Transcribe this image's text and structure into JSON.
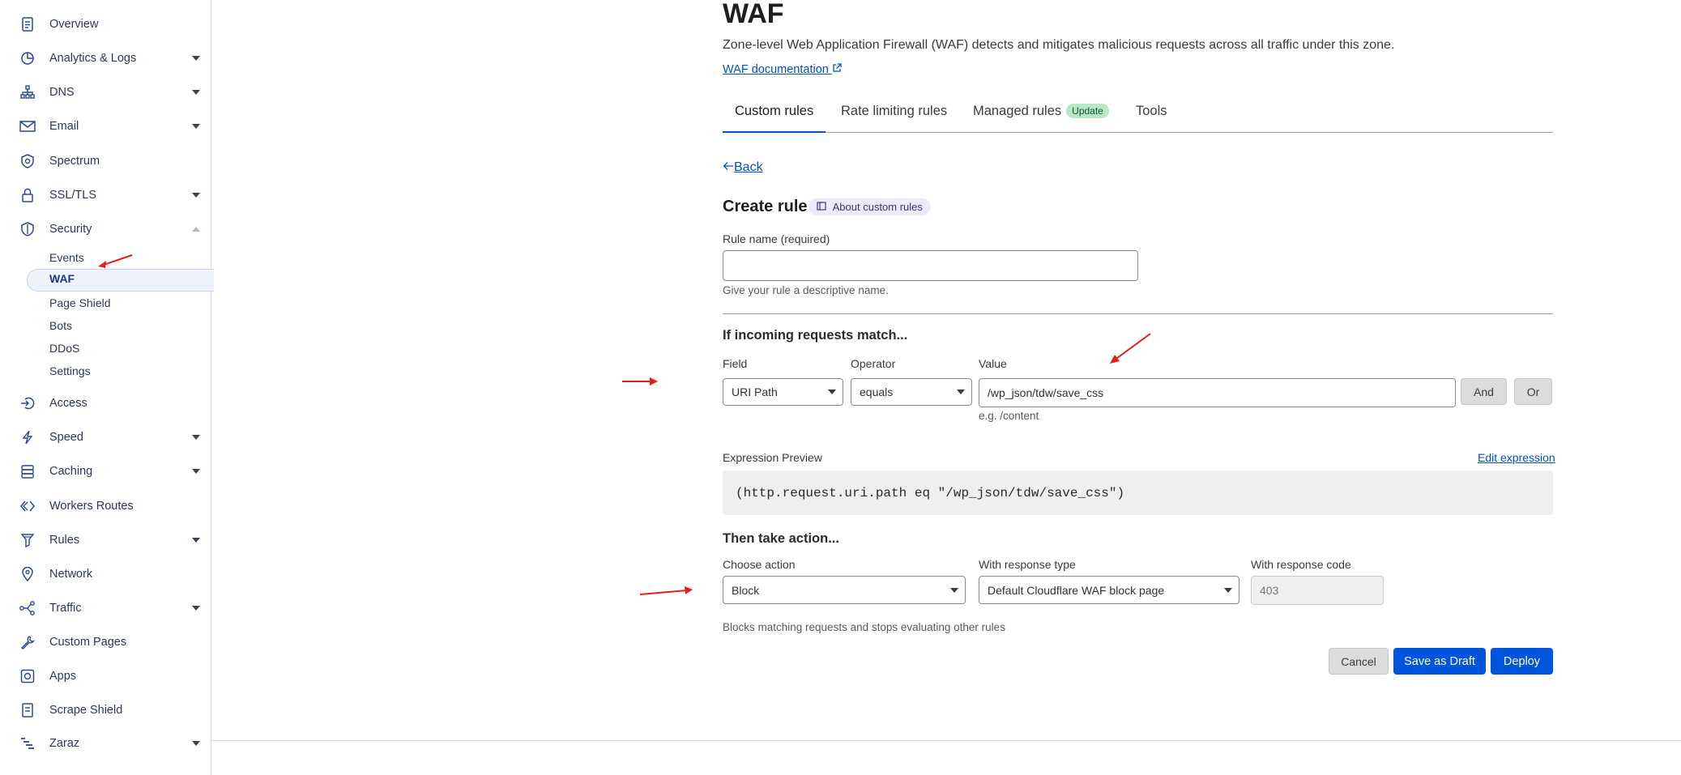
{
  "sidebar": {
    "items": [
      {
        "label": "Overview",
        "icon": "document-icon",
        "caret": false
      },
      {
        "label": "Analytics & Logs",
        "icon": "pie-chart-icon",
        "caret": true
      },
      {
        "label": "DNS",
        "icon": "network-tree-icon",
        "caret": true
      },
      {
        "label": "Email",
        "icon": "envelope-icon",
        "caret": true
      },
      {
        "label": "Spectrum",
        "icon": "shield-check-icon",
        "caret": false
      },
      {
        "label": "SSL/TLS",
        "icon": "lock-icon",
        "caret": true
      },
      {
        "label": "Security",
        "icon": "shield-icon",
        "caret": "up"
      },
      {
        "label": "Access",
        "icon": "login-icon",
        "caret": false
      },
      {
        "label": "Speed",
        "icon": "lightning-icon",
        "caret": true
      },
      {
        "label": "Caching",
        "icon": "database-icon",
        "caret": true
      },
      {
        "label": "Workers Routes",
        "icon": "diamond-code-icon",
        "caret": false
      },
      {
        "label": "Rules",
        "icon": "funnel-icon",
        "caret": true
      },
      {
        "label": "Network",
        "icon": "location-pin-icon",
        "caret": false
      },
      {
        "label": "Traffic",
        "icon": "share-nodes-icon",
        "caret": true
      },
      {
        "label": "Custom Pages",
        "icon": "wrench-icon",
        "caret": false
      },
      {
        "label": "Apps",
        "icon": "apps-icon",
        "caret": false
      },
      {
        "label": "Scrape Shield",
        "icon": "page-icon",
        "caret": false
      },
      {
        "label": "Zaraz",
        "icon": "bars-icon",
        "caret": true
      }
    ],
    "security_sub": [
      "Events",
      "WAF",
      "Page Shield",
      "Bots",
      "DDoS",
      "Settings"
    ]
  },
  "page": {
    "title": "WAF",
    "description": "Zone-level Web Application Firewall (WAF) detects and mitigates malicious requests across all traffic under this zone.",
    "doc_link": "WAF documentation"
  },
  "tabs": [
    {
      "label": "Custom rules"
    },
    {
      "label": "Rate limiting rules"
    },
    {
      "label": "Managed rules",
      "badge": "Update"
    },
    {
      "label": "Tools"
    }
  ],
  "form": {
    "back": "Back",
    "heading": "Create rule",
    "about_link": "About custom rules",
    "rule_name_label": "Rule name (required)",
    "rule_name_value": "",
    "rule_name_help": "Give your rule a descriptive name.",
    "match_heading": "If incoming requests match...",
    "field_label": "Field",
    "field_value": "URI Path",
    "operator_label": "Operator",
    "operator_value": "equals",
    "value_label": "Value",
    "value_value": "/wp_json/tdw/save_css",
    "value_help": "e.g. /content",
    "and_button": "And",
    "or_button": "Or",
    "expression_label": "Expression Preview",
    "edit_expression": "Edit expression",
    "expression": "(http.request.uri.path eq \"/wp_json/tdw/save_css\")",
    "action_heading": "Then take action...",
    "choose_action_label": "Choose action",
    "choose_action_value": "Block",
    "response_type_label": "With response type",
    "response_type_value": "Default Cloudflare WAF block page",
    "response_code_label": "With response code",
    "response_code_placeholder": "403",
    "action_help": "Blocks matching requests and stops evaluating other rules",
    "cancel": "Cancel",
    "save_draft": "Save as Draft",
    "deploy": "Deploy"
  },
  "colors": {
    "accent": "#0051c3",
    "primary_button": "#0055dc",
    "annotation_arrow": "#e0201c"
  }
}
